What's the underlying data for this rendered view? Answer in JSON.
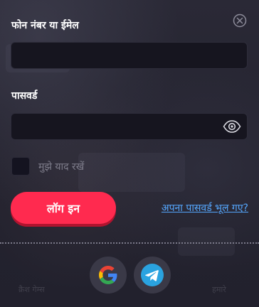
{
  "form": {
    "login_label": "फोन नंबर या ईमेल",
    "login_value": "",
    "password_label": "पासवर्ड",
    "password_value": "",
    "remember_label": "मुझे याद रखें",
    "remember_checked": false,
    "submit_label": "लॉग इन",
    "forgot_label": "अपना पासवर्ड भूल गए?"
  },
  "social": {
    "providers": [
      "google-icon",
      "telegram-icon"
    ]
  },
  "background": {
    "left_text": "क्रैश गेम्स",
    "right_text": "हमारे"
  },
  "colors": {
    "accent": "#ff2a4f",
    "link": "#55a8ff",
    "input_bg": "#16151f",
    "telegram": "#2aa3e0"
  }
}
